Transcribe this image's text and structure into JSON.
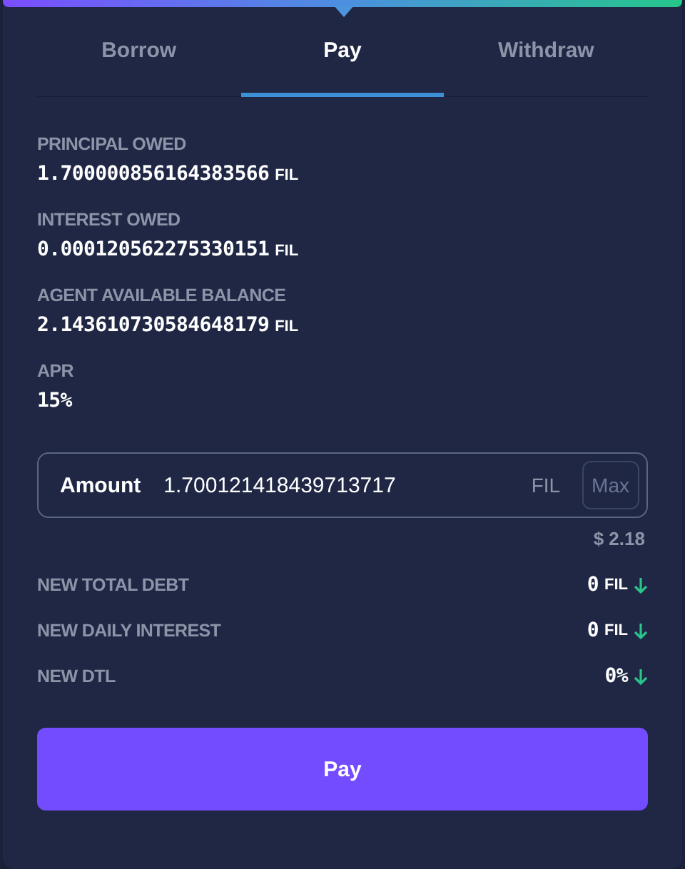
{
  "tabs": [
    {
      "label": "Borrow",
      "selected": false
    },
    {
      "label": "Pay",
      "selected": true
    },
    {
      "label": "Withdraw",
      "selected": false
    }
  ],
  "stats": [
    {
      "label": "PRINCIPAL OWED",
      "value": "1.700000856164383566",
      "unit": "FIL"
    },
    {
      "label": "INTEREST OWED",
      "value": "0.000120562275330151",
      "unit": "FIL"
    },
    {
      "label": "AGENT AVAILABLE BALANCE",
      "value": "2.143610730584648179",
      "unit": "FIL"
    },
    {
      "label": "APR",
      "value": "15%"
    }
  ],
  "amount": {
    "label": "Amount",
    "value": "1.700121418439713717",
    "unit": "FIL",
    "max_button": {
      "label": "Max",
      "disabled": true
    },
    "usd": "$ 2.18"
  },
  "summary": [
    {
      "label": "NEW TOTAL DEBT",
      "value": "0",
      "unit": "FIL",
      "kind": "decrease"
    },
    {
      "label": "NEW DAILY INTEREST",
      "value": "0",
      "unit": "FIL",
      "kind": "decrease"
    },
    {
      "label": "NEW DTL",
      "value": "0%",
      "kind": "decrease"
    }
  ],
  "submit": {
    "label": "Pay"
  }
}
